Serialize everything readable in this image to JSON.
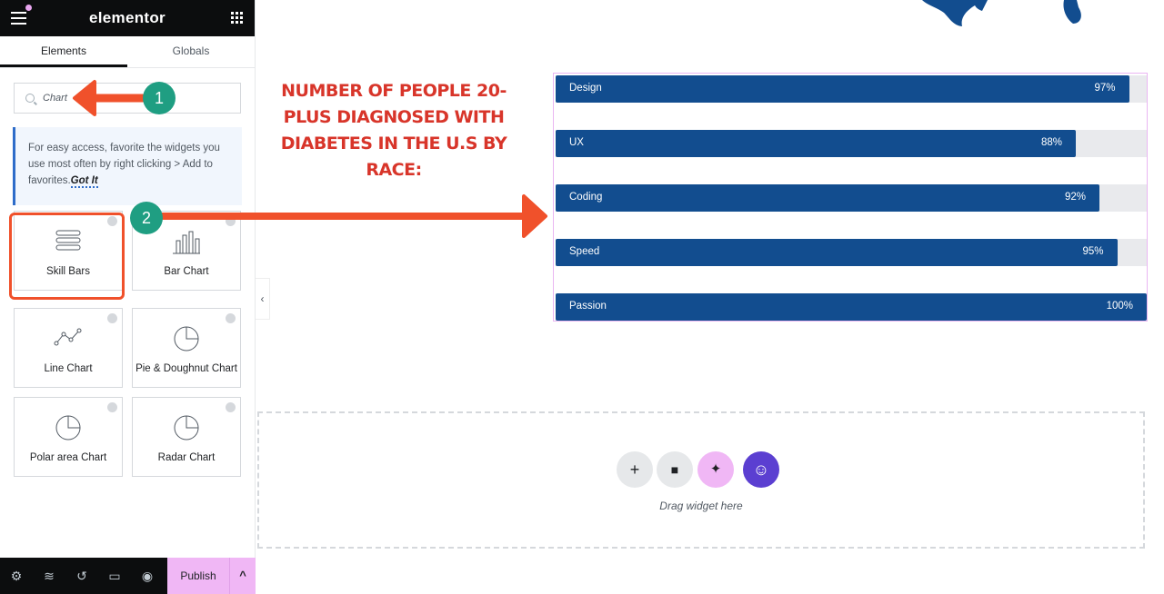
{
  "app": {
    "logo": "elementor"
  },
  "tabs": [
    {
      "label": "Elements",
      "active": true
    },
    {
      "label": "Globals",
      "active": false
    }
  ],
  "search": {
    "value": "Chart"
  },
  "tip": {
    "text": "For easy access, favorite the widgets you use most often by right clicking > Add to favorites.",
    "link": "Got It"
  },
  "widgets": [
    {
      "label": "Skill Bars",
      "icon": "skill-bars-icon"
    },
    {
      "label": "Bar Chart",
      "icon": "bar-chart-icon"
    },
    {
      "label": "Line Chart",
      "icon": "line-chart-icon"
    },
    {
      "label": "Pie & Doughnut Chart",
      "icon": "pie-chart-icon"
    },
    {
      "label": "Polar area Chart",
      "icon": "polar-chart-icon"
    },
    {
      "label": "Radar Chart",
      "icon": "radar-chart-icon"
    }
  ],
  "footer": {
    "publish": "Publish"
  },
  "annotations": {
    "step1": "1",
    "step2": "2",
    "color": "#f0512b",
    "badge_color": "#1f9e82"
  },
  "heading": "Number of people 20-plus diagnosed with diabetes in the U.S by race:",
  "skills": [
    {
      "name": "Design",
      "percent": 97,
      "label": "97%"
    },
    {
      "name": "UX",
      "percent": 88,
      "label": "88%"
    },
    {
      "name": "Coding",
      "percent": 92,
      "label": "92%"
    },
    {
      "name": "Speed",
      "percent": 95,
      "label": "95%"
    },
    {
      "name": "Passion",
      "percent": 100,
      "label": "100%"
    }
  ],
  "colors": {
    "bar": "#124d8f",
    "track": "#e9eaed",
    "heading": "#d8352a",
    "publish": "#f0b7f5"
  },
  "dropzone": {
    "text": "Drag widget here"
  }
}
